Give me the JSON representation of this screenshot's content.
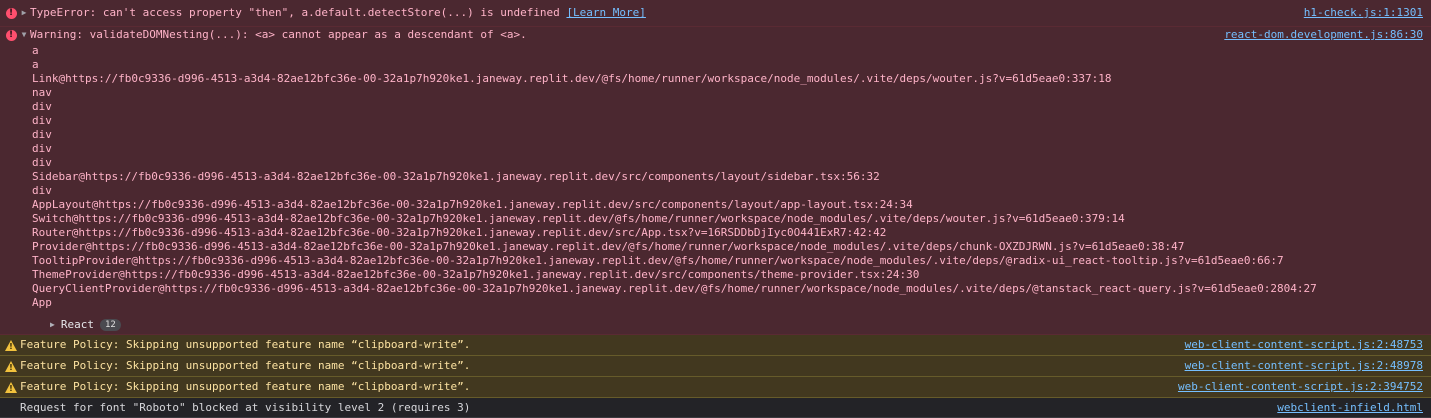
{
  "messages": [
    {
      "level": "error",
      "text": "TypeError: can't access property \"then\", a.default.detectStore(...) is undefined",
      "learn_more": "[Learn More]",
      "source": "h1-check.js:1:1301"
    },
    {
      "level": "error",
      "text": "Warning: validateDOMNesting(...): <a> cannot appear as a descendant of <a>.",
      "source": "react-dom.development.js:86:30",
      "stack": [
        "a",
        "a",
        "Link@https://fb0c9336-d996-4513-a3d4-82ae12bfc36e-00-32a1p7h920ke1.janeway.replit.dev/@fs/home/runner/workspace/node_modules/.vite/deps/wouter.js?v=61d5eae0:337:18",
        "nav",
        "div",
        "div",
        "div",
        "div",
        "div",
        "Sidebar@https://fb0c9336-d996-4513-a3d4-82ae12bfc36e-00-32a1p7h920ke1.janeway.replit.dev/src/components/layout/sidebar.tsx:56:32",
        "div",
        "AppLayout@https://fb0c9336-d996-4513-a3d4-82ae12bfc36e-00-32a1p7h920ke1.janeway.replit.dev/src/components/layout/app-layout.tsx:24:34",
        "Switch@https://fb0c9336-d996-4513-a3d4-82ae12bfc36e-00-32a1p7h920ke1.janeway.replit.dev/@fs/home/runner/workspace/node_modules/.vite/deps/wouter.js?v=61d5eae0:379:14",
        "Router@https://fb0c9336-d996-4513-a3d4-82ae12bfc36e-00-32a1p7h920ke1.janeway.replit.dev/src/App.tsx?v=16RSDDbDjIyc0O441ExR7:42:42",
        "Provider@https://fb0c9336-d996-4513-a3d4-82ae12bfc36e-00-32a1p7h920ke1.janeway.replit.dev/@fs/home/runner/workspace/node_modules/.vite/deps/chunk-OXZDJRWN.js?v=61d5eae0:38:47",
        "TooltipProvider@https://fb0c9336-d996-4513-a3d4-82ae12bfc36e-00-32a1p7h920ke1.janeway.replit.dev/@fs/home/runner/workspace/node_modules/.vite/deps/@radix-ui_react-tooltip.js?v=61d5eae0:66:7",
        "ThemeProvider@https://fb0c9336-d996-4513-a3d4-82ae12bfc36e-00-32a1p7h920ke1.janeway.replit.dev/src/components/theme-provider.tsx:24:30",
        "QueryClientProvider@https://fb0c9336-d996-4513-a3d4-82ae12bfc36e-00-32a1p7h920ke1.janeway.replit.dev/@fs/home/runner/workspace/node_modules/.vite/deps/@tanstack_react-query.js?v=61d5eae0:2804:27",
        "App"
      ],
      "group_label": "React",
      "group_count": "12"
    },
    {
      "level": "warn",
      "text": "Feature Policy: Skipping unsupported feature name “clipboard-write”.",
      "source": "web-client-content-script.js:2:48753"
    },
    {
      "level": "warn",
      "text": "Feature Policy: Skipping unsupported feature name “clipboard-write”.",
      "source": "web-client-content-script.js:2:48978"
    },
    {
      "level": "warn",
      "text": "Feature Policy: Skipping unsupported feature name “clipboard-write”.",
      "source": "web-client-content-script.js:2:394752"
    },
    {
      "level": "log",
      "text": "Request for font \"Roboto\" blocked at visibility level 2 (requires 3)",
      "source": "webclient-infield.html"
    }
  ],
  "colors": {
    "error_bg": "#4b2830",
    "warn_bg": "#42381f",
    "link": "#75bfff"
  },
  "icons": {
    "error": "error-circle-icon",
    "warning": "warning-triangle-icon",
    "expand": "disclosure-triangle-icon"
  }
}
